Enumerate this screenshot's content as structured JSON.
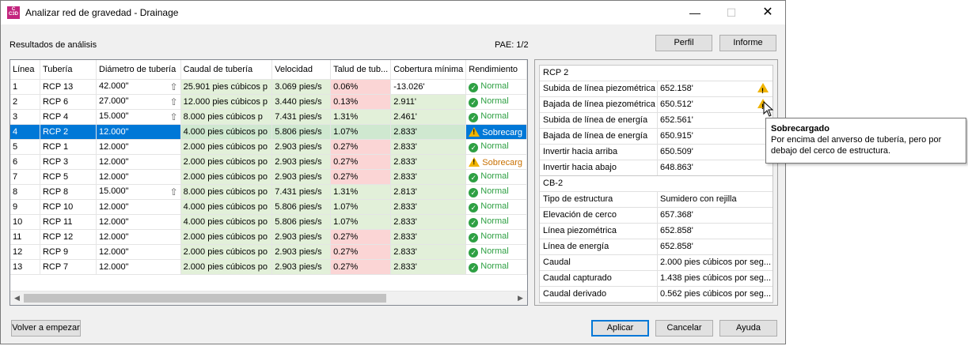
{
  "window": {
    "title": "Analizar red de gravedad - Drainage",
    "icon_text": "C",
    "icon_sub": "C3D"
  },
  "results_label": "Resultados de análisis",
  "pae_label": "PAE: 1/2",
  "buttons": {
    "perfil": "Perfil",
    "informe": "Informe",
    "restart": "Volver a empezar",
    "apply": "Aplicar",
    "cancel": "Cancelar",
    "help": "Ayuda"
  },
  "grid": {
    "columns": [
      "Línea",
      "Tubería",
      "Diámetro de tubería",
      "Caudal de tubería",
      "Velocidad",
      "Talud de tub...",
      "Cobertura mínima",
      "Rendimiento"
    ],
    "rows": [
      {
        "linea": "1",
        "tuberia": "RCP 13",
        "diametro": "42.000\"",
        "arrow": true,
        "caudal": "25.901 pies cúbicos p",
        "velocidad": "3.069 pies/s",
        "talud": "0.06%",
        "cobertura": "-13.026'",
        "rend": "Normal",
        "status": "ok"
      },
      {
        "linea": "2",
        "tuberia": "RCP 6",
        "diametro": "27.000\"",
        "arrow": true,
        "caudal": "12.000 pies cúbicos p",
        "velocidad": "3.440 pies/s",
        "talud": "0.13%",
        "cobertura": "2.911'",
        "rend": "Normal",
        "status": "ok"
      },
      {
        "linea": "3",
        "tuberia": "RCP 4",
        "diametro": "15.000\"",
        "arrow": true,
        "caudal": "8.000 pies cúbicos p",
        "velocidad": "7.431 pies/s",
        "talud": "1.31%",
        "cobertura": "2.461'",
        "rend": "Normal",
        "status": "ok"
      },
      {
        "linea": "4",
        "tuberia": "RCP 2",
        "diametro": "12.000\"",
        "arrow": false,
        "caudal": "4.000 pies cúbicos po",
        "velocidad": "5.806 pies/s",
        "talud": "1.07%",
        "cobertura": "2.833'",
        "rend": "Sobrecarg",
        "status": "warn",
        "selected": true
      },
      {
        "linea": "5",
        "tuberia": "RCP 1",
        "diametro": "12.000\"",
        "arrow": false,
        "caudal": "2.000 pies cúbicos po",
        "velocidad": "2.903 pies/s",
        "talud": "0.27%",
        "cobertura": "2.833'",
        "rend": "Normal",
        "status": "ok"
      },
      {
        "linea": "6",
        "tuberia": "RCP 3",
        "diametro": "12.000\"",
        "arrow": false,
        "caudal": "2.000 pies cúbicos po",
        "velocidad": "2.903 pies/s",
        "talud": "0.27%",
        "cobertura": "2.833'",
        "rend": "Sobrecarg",
        "status": "warn"
      },
      {
        "linea": "7",
        "tuberia": "RCP 5",
        "diametro": "12.000\"",
        "arrow": false,
        "caudal": "2.000 pies cúbicos po",
        "velocidad": "2.903 pies/s",
        "talud": "0.27%",
        "cobertura": "2.833'",
        "rend": "Normal",
        "status": "ok"
      },
      {
        "linea": "8",
        "tuberia": "RCP 8",
        "diametro": "15.000\"",
        "arrow": true,
        "caudal": "8.000 pies cúbicos po",
        "velocidad": "7.431 pies/s",
        "talud": "1.31%",
        "cobertura": "2.813'",
        "rend": "Normal",
        "status": "ok"
      },
      {
        "linea": "9",
        "tuberia": "RCP 10",
        "diametro": "12.000\"",
        "arrow": false,
        "caudal": "4.000 pies cúbicos po",
        "velocidad": "5.806 pies/s",
        "talud": "1.07%",
        "cobertura": "2.833'",
        "rend": "Normal",
        "status": "ok"
      },
      {
        "linea": "10",
        "tuberia": "RCP 11",
        "diametro": "12.000\"",
        "arrow": false,
        "caudal": "4.000 pies cúbicos po",
        "velocidad": "5.806 pies/s",
        "talud": "1.07%",
        "cobertura": "2.833'",
        "rend": "Normal",
        "status": "ok"
      },
      {
        "linea": "11",
        "tuberia": "RCP 12",
        "diametro": "12.000\"",
        "arrow": false,
        "caudal": "2.000 pies cúbicos po",
        "velocidad": "2.903 pies/s",
        "talud": "0.27%",
        "cobertura": "2.833'",
        "rend": "Normal",
        "status": "ok"
      },
      {
        "linea": "12",
        "tuberia": "RCP 9",
        "diametro": "12.000\"",
        "arrow": false,
        "caudal": "2.000 pies cúbicos po",
        "velocidad": "2.903 pies/s",
        "talud": "0.27%",
        "cobertura": "2.833'",
        "rend": "Normal",
        "status": "ok"
      },
      {
        "linea": "13",
        "tuberia": "RCP 7",
        "diametro": "12.000\"",
        "arrow": false,
        "caudal": "2.000 pies cúbicos po",
        "velocidad": "2.903 pies/s",
        "talud": "0.27%",
        "cobertura": "2.833'",
        "rend": "Normal",
        "status": "ok"
      }
    ]
  },
  "pipe_props": {
    "title": "RCP 2",
    "rows": [
      {
        "k": "Subida de línea piezométrica",
        "v": "652.158'",
        "warn": true
      },
      {
        "k": "Bajada de línea piezométrica",
        "v": "650.512'",
        "warn": true
      },
      {
        "k": "Subida de línea de energía",
        "v": "652.561'",
        "warn": false
      },
      {
        "k": "Bajada de línea de energía",
        "v": "650.915'",
        "warn": false
      },
      {
        "k": "Invertir hacia arriba",
        "v": "650.509'",
        "warn": false
      },
      {
        "k": "Invertir hacia abajo",
        "v": "648.863'",
        "warn": false
      }
    ]
  },
  "struct_props": {
    "title": "CB-2",
    "rows": [
      {
        "k": "Tipo de estructura",
        "v": "Sumidero con rejilla"
      },
      {
        "k": "Elevación de cerco",
        "v": "657.368'"
      },
      {
        "k": "Línea piezométrica",
        "v": "652.858'"
      },
      {
        "k": "Línea de energía",
        "v": "652.858'"
      },
      {
        "k": "Caudal",
        "v": "2.000 pies cúbicos por seg..."
      },
      {
        "k": "Caudal capturado",
        "v": "1.438 pies cúbicos por seg..."
      },
      {
        "k": "Caudal derivado",
        "v": "0.562 pies cúbicos por seg..."
      }
    ]
  },
  "tooltip": {
    "title": "Sobrecargado",
    "body": "Por encima del anverso de tubería, pero por debajo del cerco de estructura."
  }
}
